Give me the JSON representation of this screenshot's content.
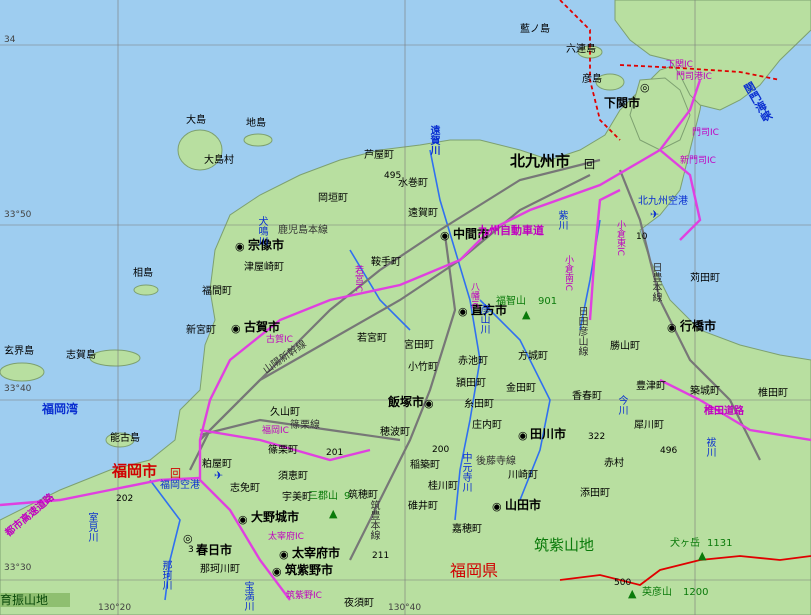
{
  "map": {
    "colors": {
      "sea": "#9ecdf0",
      "land": "#b8dfa0",
      "highway": "#e040e0",
      "rail": "#888888",
      "river": "#3070f0",
      "border": "#e00000"
    },
    "grid_labels": [
      "34",
      "33°50",
      "33°40",
      "33°30",
      "130°20",
      "130°40"
    ],
    "cities": [
      "下関市",
      "北九州市",
      "中間市",
      "宗像市",
      "直方市",
      "古賀市",
      "行橋市",
      "飯塚市",
      "福岡市",
      "大野城市",
      "太宰府市",
      "筑紫野市",
      "春日市",
      "田川市",
      "山田市"
    ],
    "towns": [
      "岡垣町",
      "芦屋町",
      "水巻町",
      "遠賀町",
      "津屋崎町",
      "福間町",
      "新宮町",
      "鞍手町",
      "若宮町",
      "宮田町",
      "小竹町",
      "赤池町",
      "方城町",
      "金田町",
      "香春町",
      "勝山町",
      "豊津町",
      "苅田町",
      "築城町",
      "椎田町",
      "犀川町",
      "久山町",
      "篠栗町",
      "粕屋町",
      "志免町",
      "須恵町",
      "宇美町",
      "穂波町",
      "庄内町",
      "稲築町",
      "桂川町",
      "嘉穂町",
      "碓井町",
      "糸田町",
      "川崎町",
      "添田町",
      "赤村",
      "頴田町",
      "筑穂町",
      "那珂川町",
      "夜須町",
      "大島村"
    ],
    "islands": [
      "藍ノ島",
      "六連島",
      "彦島",
      "大島",
      "地島",
      "相島",
      "玄界島",
      "志賀島",
      "能古島"
    ],
    "prefecture": "福岡県",
    "mountains": [
      {
        "name": "福智山",
        "elev": "901"
      },
      {
        "name": "三郡山",
        "elev": "9"
      },
      {
        "name": "犬ヶ岳",
        "elev": "1131"
      },
      {
        "name": "英彦山",
        "elev": "1200"
      }
    ],
    "range": "筑紫山地",
    "sea": [
      "福岡湾"
    ],
    "airports": [
      "北九州空港",
      "福岡空港"
    ],
    "railways": [
      "鹿児島本線",
      "山陽新幹線",
      "日豊本線",
      "篠栗線",
      "後藤寺線",
      "筑豊本線",
      "日田彦山線"
    ],
    "expressways": [
      "九州自動車道",
      "関門海峡",
      "椎田道路",
      "都市高速道路"
    ],
    "interchanges": [
      "下関IC",
      "門司港IC",
      "門司IC",
      "新門司IC",
      "小倉東IC",
      "小倉南IC",
      "若宮IC",
      "古賀IC",
      "福岡IC",
      "太宰府IC",
      "筑紫野IC",
      "八幡IC"
    ],
    "rivers": [
      "遠賀川",
      "犬鳴川",
      "彦山川",
      "紫川",
      "今川",
      "祓川",
      "那珂川",
      "宝満川",
      "室見川",
      "中元寺川"
    ],
    "routes": [
      "495",
      "201",
      "200",
      "322",
      "211",
      "496",
      "10",
      "3",
      "202",
      "500"
    ],
    "misc": [
      "育振山地"
    ]
  }
}
